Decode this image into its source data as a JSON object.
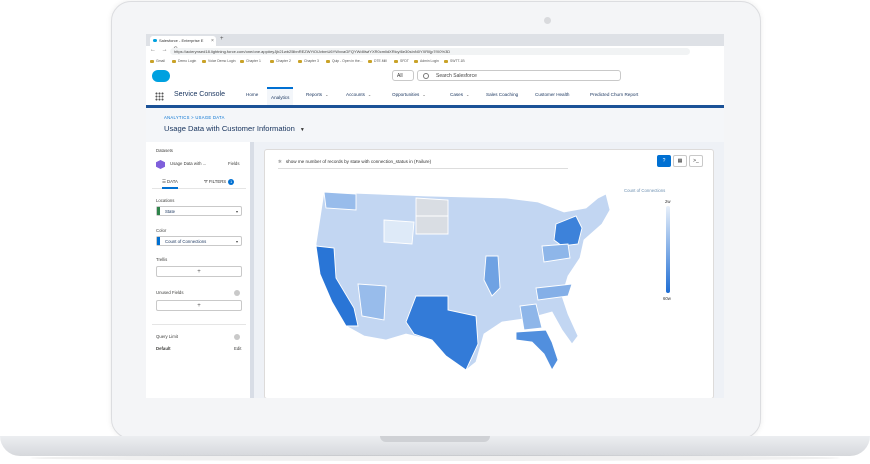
{
  "browser": {
    "tab_title": "Salesforce - Enterprise E",
    "tab_close": "×",
    "new_tab": "+",
    "nav_buttons": "← → C",
    "url": "https://acierynsed18.lightning.force.com/one/one.app#eyJjb21wb25lbnREZWYiOiJvbmU6YWxvaGFQYWdlIiwiYXR0cmlidXRlcyI6e30sInN0YXRlIjp7fX0%3D",
    "bookmarks": [
      "Gmail",
      "Demo Login",
      "Voice Demo Login",
      "Chapter 1",
      "Chapter 2",
      "Chapter 3",
      "Quip - Open in the...",
      "DTE.Mill",
      "SFDT",
      "Admin Login",
      "SWTT-1B"
    ]
  },
  "header": {
    "search_scope": "All",
    "search_placeholder": "Search Salesforce"
  },
  "nav": {
    "app_name": "Service Console",
    "items": [
      {
        "label": "Home",
        "chevron": ""
      },
      {
        "label": "Analytics",
        "chevron": ""
      },
      {
        "label": "Reports",
        "chevron": "⌄"
      },
      {
        "label": "Accounts",
        "chevron": "⌄"
      },
      {
        "label": "Opportunities",
        "chevron": "⌄"
      },
      {
        "label": "Cases",
        "chevron": "⌄"
      },
      {
        "label": "Sales Coaching",
        "chevron": ""
      },
      {
        "label": "Customer Health",
        "chevron": ""
      },
      {
        "label": "Predicted Churn Report",
        "chevron": ""
      }
    ]
  },
  "page": {
    "breadcrumb": "ANALYTICS > USAGE DATA",
    "title": "Usage Data with Customer Information",
    "title_chevron": "▼"
  },
  "left_panel": {
    "datasets_label": "Datasets",
    "dataset_name": "Usage Data with ...",
    "fields_link": "Fields",
    "tab_data": "DATA",
    "tab_filters": "FILTERS",
    "filters_count": "1",
    "locations_label": "Locations",
    "location_value": "State",
    "color_label": "Color",
    "color_value": "Count of Connections",
    "trellis_label": "Trellis",
    "add_symbol": "+",
    "unused_fields_label": "Unused Fields",
    "query_limit_label": "Query Limit",
    "query_limit_value": "Default",
    "edit_label": "Edit",
    "location_accent": "#2e844a",
    "color_accent": "#0070d2"
  },
  "query": {
    "icon": "✲",
    "text": "show me number of records by state with connection_status in (Failure)"
  },
  "view_buttons": [
    "?",
    "▦",
    ">_"
  ],
  "legend": {
    "title": "Count of Connections",
    "min": "2w",
    "max": "60w"
  },
  "chart_data": {
    "type": "choropleth-map",
    "region": "United States",
    "measure": "Count of Connections",
    "color_scale": [
      "#e8f0fa",
      "#1f6ed4"
    ],
    "states": [
      {
        "state": "CA",
        "level": 0.95
      },
      {
        "state": "TX",
        "level": 0.9
      },
      {
        "state": "FL",
        "level": 0.75
      },
      {
        "state": "NY",
        "level": 0.85
      },
      {
        "state": "IL",
        "level": 0.6
      },
      {
        "state": "PA",
        "level": 0.45
      },
      {
        "state": "NC",
        "level": 0.5
      },
      {
        "state": "GA",
        "level": 0.45
      },
      {
        "state": "WA",
        "level": 0.4
      },
      {
        "state": "AZ",
        "level": 0.4
      },
      {
        "state": "ND",
        "level": 0.0
      },
      {
        "state": "SD",
        "level": 0.0
      },
      {
        "state": "WY",
        "level": 0.05
      }
    ]
  }
}
